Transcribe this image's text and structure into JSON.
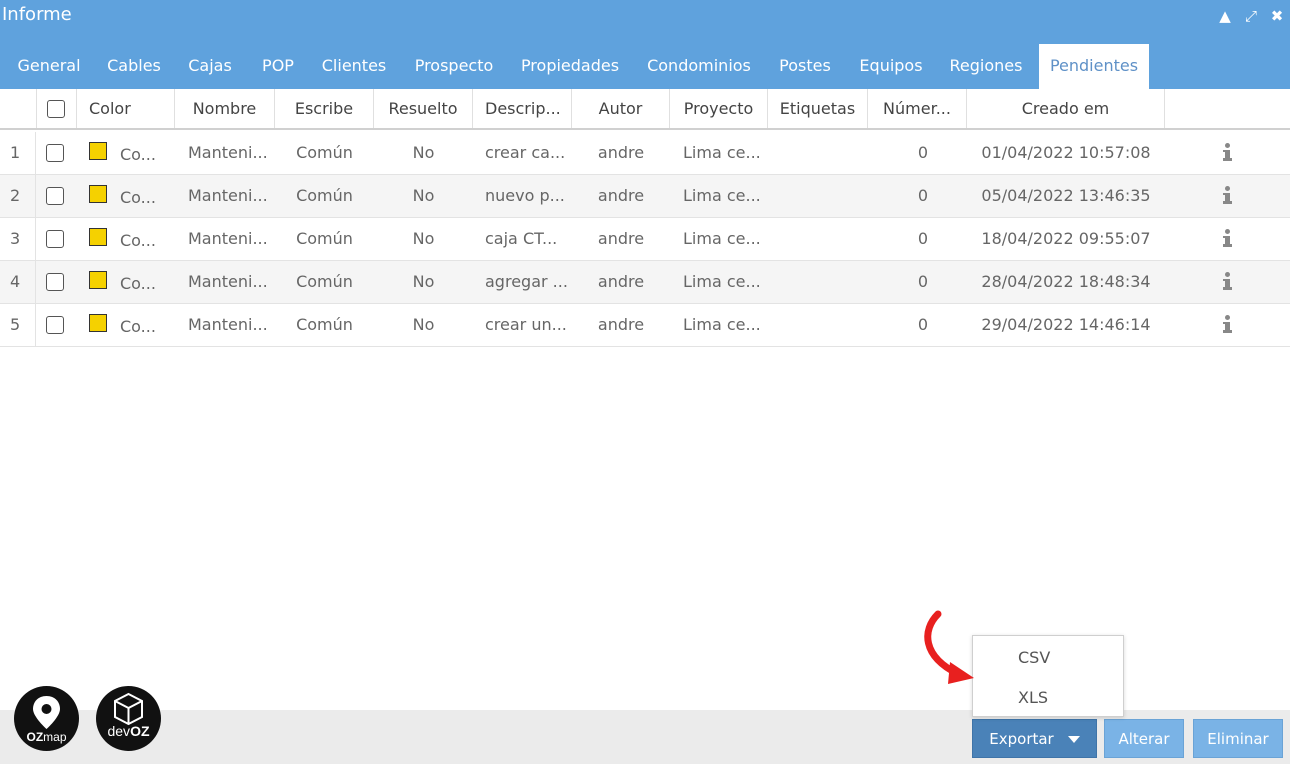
{
  "window": {
    "title": "Informe",
    "controls": [
      "collapse-icon",
      "maximize-icon",
      "close-icon"
    ]
  },
  "tabs": [
    {
      "label": "General"
    },
    {
      "label": "Cables"
    },
    {
      "label": "Cajas"
    },
    {
      "label": "POP"
    },
    {
      "label": "Clientes"
    },
    {
      "label": "Prospecto"
    },
    {
      "label": "Propiedades"
    },
    {
      "label": "Condominios"
    },
    {
      "label": "Postes"
    },
    {
      "label": "Equipos"
    },
    {
      "label": "Regiones"
    },
    {
      "label": "Pendientes",
      "active": true
    }
  ],
  "table": {
    "headers": {
      "color": "Color",
      "nombre": "Nombre",
      "escribe": "Escribe",
      "resuelto": "Resuelto",
      "descripcion": "Descrip...",
      "autor": "Autor",
      "proyecto": "Proyecto",
      "etiquetas": "Etiquetas",
      "numero": "Númer...",
      "creado": "Creado em"
    },
    "rows": [
      {
        "num": "1",
        "color_label": "Co...",
        "nombre": "Manteni...",
        "escribe": "Común",
        "resuelto": "No",
        "descripcion": "crear ca...",
        "autor": "andre",
        "proyecto": "Lima ce...",
        "etiquetas": "",
        "numero": "0",
        "creado": "01/04/2022 10:57:08"
      },
      {
        "num": "2",
        "color_label": "Co...",
        "nombre": "Manteni...",
        "escribe": "Común",
        "resuelto": "No",
        "descripcion": "nuevo p...",
        "autor": "andre",
        "proyecto": "Lima ce...",
        "etiquetas": "",
        "numero": "0",
        "creado": "05/04/2022 13:46:35"
      },
      {
        "num": "3",
        "color_label": "Co...",
        "nombre": "Manteni...",
        "escribe": "Común",
        "resuelto": "No",
        "descripcion": "caja CT...",
        "autor": "andre",
        "proyecto": "Lima ce...",
        "etiquetas": "",
        "numero": "0",
        "creado": "18/04/2022 09:55:07"
      },
      {
        "num": "4",
        "color_label": "Co...",
        "nombre": "Manteni...",
        "escribe": "Común",
        "resuelto": "No",
        "descripcion": "agregar ...",
        "autor": "andre",
        "proyecto": "Lima ce...",
        "etiquetas": "",
        "numero": "0",
        "creado": "28/04/2022 18:48:34"
      },
      {
        "num": "5",
        "color_label": "Co...",
        "nombre": "Manteni...",
        "escribe": "Común",
        "resuelto": "No",
        "descripcion": "crear un...",
        "autor": "andre",
        "proyecto": "Lima ce...",
        "etiquetas": "",
        "numero": "0",
        "creado": "29/04/2022 14:46:14"
      }
    ],
    "swatch_color": "#f5d100"
  },
  "export_menu": {
    "items": [
      "CSV",
      "XLS"
    ]
  },
  "footer": {
    "export_label": "Exportar",
    "alter_label": "Alterar",
    "delete_label": "Eliminar",
    "logos": [
      {
        "text_a": "OZ",
        "text_b": "map"
      },
      {
        "text_a": "dev",
        "text_b": "OZ"
      }
    ]
  },
  "colors": {
    "header_blue": "#5fa2dd",
    "button_primary": "#4a82b8",
    "button_secondary": "#7ab3e6",
    "annotation_arrow": "#e8201f"
  }
}
